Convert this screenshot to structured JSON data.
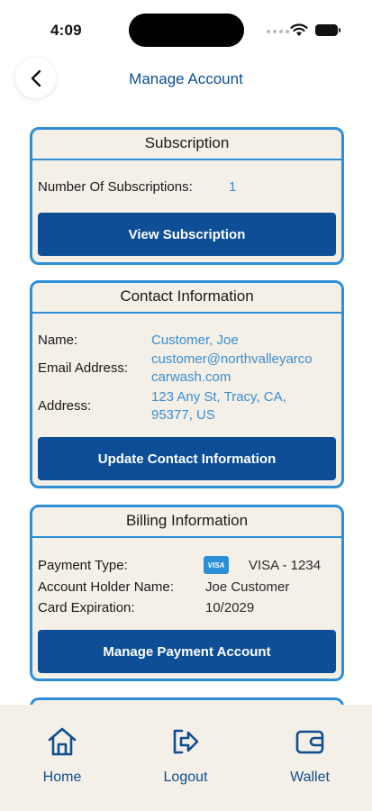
{
  "status_bar": {
    "time": "4:09"
  },
  "header": {
    "title": "Manage Account"
  },
  "subscription": {
    "title": "Subscription",
    "count_label": "Number Of Subscriptions:",
    "count_value": "1",
    "button_label": "View Subscription"
  },
  "contact": {
    "title": "Contact Information",
    "name_label": "Name:",
    "name_value": "Customer, Joe",
    "email_label": "Email Address:",
    "email_line1": "customer@northvalleyarco",
    "email_line2": "carwash.com",
    "address_label": "Address:",
    "address_line1": "123 Any St, Tracy, CA,",
    "address_line2": "95377, US",
    "button_label": "Update Contact Information"
  },
  "billing": {
    "title": "Billing Information",
    "payment_type_label": "Payment Type:",
    "card_brand_badge": "VISA",
    "payment_type_value": "VISA - 1234",
    "holder_label": "Account Holder Name:",
    "holder_value": "Joe Customer",
    "expiration_label": "Card Expiration:",
    "expiration_value": "10/2029",
    "button_label": "Manage Payment Account"
  },
  "bottom_nav": {
    "items": [
      {
        "label": "Home",
        "icon": "home-icon"
      },
      {
        "label": "Logout",
        "icon": "logout-icon"
      },
      {
        "label": "Wallet",
        "icon": "wallet-icon"
      }
    ]
  },
  "colors": {
    "brand_blue": "#0d4e96",
    "card_border": "#2f8fd6",
    "card_bg": "#f4efe7",
    "value_blue": "#3a8fd0"
  }
}
